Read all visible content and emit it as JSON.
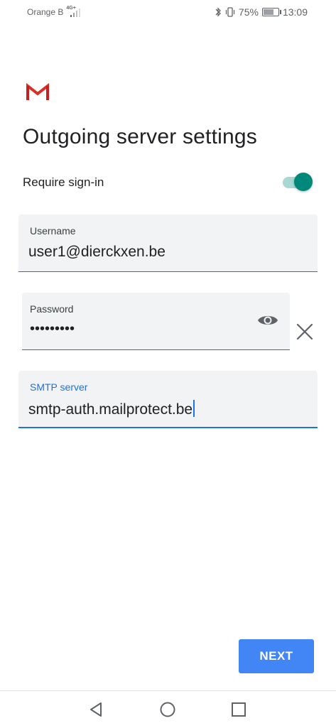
{
  "status_bar": {
    "carrier": "Orange B",
    "network_tag": "4G+",
    "battery_percent": "75%",
    "battery_level": 0.75,
    "time": "13:09",
    "icons": [
      "signal-icon",
      "bluetooth-icon",
      "vibrate-icon",
      "battery-icon"
    ]
  },
  "header": {
    "logo": "gmail-logo",
    "title": "Outgoing server settings"
  },
  "signin": {
    "label": "Require sign-in",
    "enabled": true
  },
  "fields": {
    "username": {
      "label": "Username",
      "value": "user1@dierckxen.be"
    },
    "password": {
      "label": "Password",
      "value": "•••••••••",
      "toggle_icon": "eye-icon",
      "clear_icon": "close-icon"
    },
    "smtp": {
      "label": "SMTP server",
      "value": "smtp-auth.mailprotect.be"
    }
  },
  "actions": {
    "next_label": "NEXT"
  },
  "nav_bar": {
    "icons": [
      "back-icon",
      "home-icon",
      "recents-icon"
    ]
  },
  "colors": {
    "accent": "#1a73e8",
    "toggle_on": "#00897b",
    "button": "#4285f4",
    "field_bg": "#f1f3f4"
  }
}
